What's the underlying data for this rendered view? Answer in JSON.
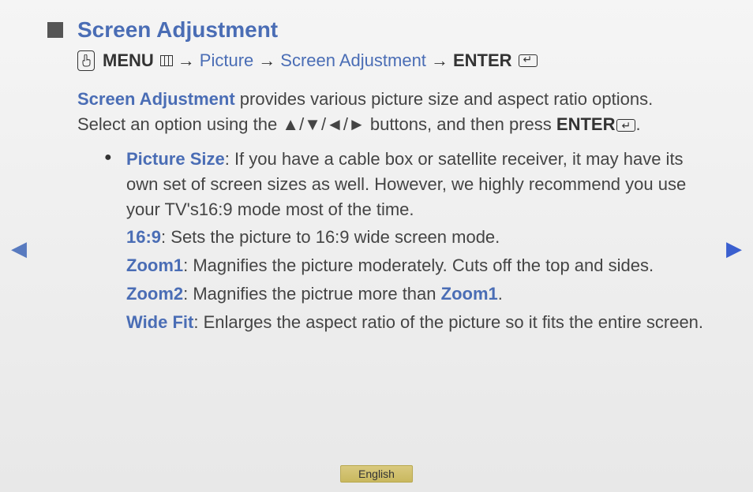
{
  "title": "Screen Adjustment",
  "menu_path": {
    "menu": "MENU",
    "picture": "Picture",
    "screen_adj": "Screen Adjustment",
    "enter": "ENTER",
    "arrow": "→"
  },
  "intro": {
    "lead_blue": "Screen Adjustment",
    "p1_a": " provides various picture size and aspect ratio options. Select an option using the ",
    "nav_glyphs": "▲/▼/◄/►",
    "p1_b": " buttons, and then press ",
    "enter": "ENTER",
    "period": "."
  },
  "options": {
    "picture_size": {
      "label": "Picture Size",
      "text": ": If you have a cable box or satellite receiver, it may have its own set of screen sizes as well. However, we highly recommend you use your TV's16:9 mode most of the time."
    },
    "sixteen_nine": {
      "label": "16:9",
      "text": ": Sets the picture to 16:9 wide screen mode."
    },
    "zoom1": {
      "label": "Zoom1",
      "text": ": Magnifies the picture moderately. Cuts off the top and sides."
    },
    "zoom2": {
      "label": "Zoom2",
      "text_a": ": Magnifies the pictrue more than ",
      "ref": "Zoom1",
      "text_b": "."
    },
    "wide_fit": {
      "label": "Wide Fit",
      "text": ": Enlarges the aspect ratio of the picture so it fits the entire screen."
    }
  },
  "nav": {
    "left": "◀",
    "right": "▶"
  },
  "language": "English"
}
